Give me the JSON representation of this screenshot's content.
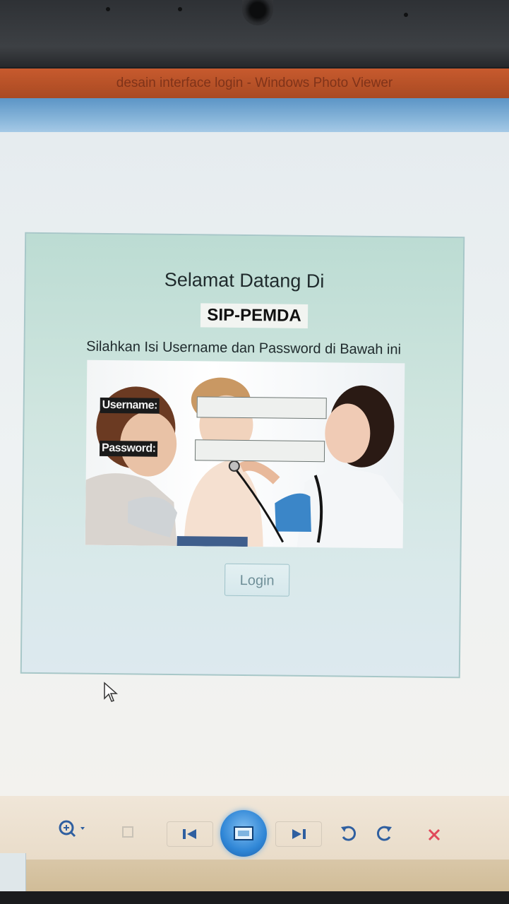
{
  "window": {
    "title": "desain interface login - Windows Photo Viewer"
  },
  "login_form": {
    "welcome": "Selamat Datang Di",
    "app_name": "SIP-PEMDA",
    "instruction": "Silahkan Isi Username dan Password di Bawah ini",
    "username_label": "Username:",
    "username_value": "",
    "password_label": "Password:",
    "password_value": "",
    "login_label": "Login"
  },
  "toolbar": {
    "icons": [
      "zoom-icon",
      "actual-size-icon",
      "previous-icon",
      "slideshow-icon",
      "next-icon",
      "rotate-left-icon",
      "rotate-right-icon",
      "delete-icon"
    ]
  },
  "colors": {
    "titlebar": "#c75a2e",
    "panel_bg": "#cfe5df",
    "slideshow": "#2f86d6",
    "delete": "#e0485a"
  }
}
